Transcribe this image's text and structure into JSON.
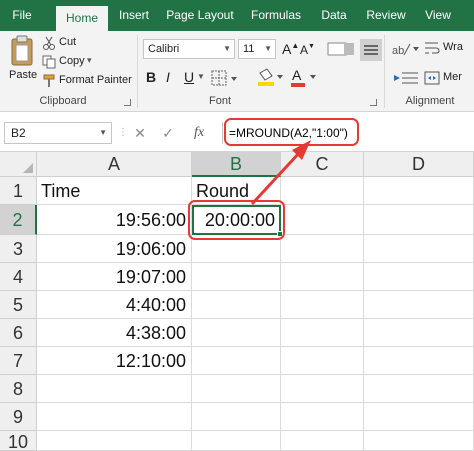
{
  "ribbon": {
    "tabs": [
      "File",
      "Home",
      "Insert",
      "Page Layout",
      "Formulas",
      "Data",
      "Review",
      "View"
    ],
    "active_tab": "Home",
    "clipboard": {
      "paste": "Paste",
      "cut": "Cut",
      "copy": "Copy",
      "copy_dropdown": "▾",
      "format_painter": "Format Painter",
      "group_label": "Clipboard"
    },
    "font": {
      "name": "Calibri",
      "size": "11",
      "grow": "A",
      "shrink": "A",
      "bold": "B",
      "italic": "I",
      "underline": "U",
      "font_color": "A",
      "group_label": "Font"
    },
    "alignment": {
      "wrap": "Wra",
      "merge": "Mer",
      "group_label": "Alignment"
    }
  },
  "formula_bar": {
    "name_box": "B2",
    "cancel": "✕",
    "enter": "✓",
    "fx": "fx",
    "formula": "=MROUND(A2,\"1:00\")"
  },
  "sheet": {
    "columns": [
      "A",
      "B",
      "C",
      "D"
    ],
    "selected_column": "B",
    "rows": [
      "1",
      "2",
      "3",
      "4",
      "5",
      "6",
      "7",
      "8",
      "9",
      "10"
    ],
    "selected_row": "2",
    "cells": {
      "A1": "Time",
      "B1": "Round",
      "A2": "19:56:00",
      "B2": "20:00:00",
      "A3": "19:06:00",
      "A4": "19:07:00",
      "A5": "4:40:00",
      "A6": "4:38:00",
      "A7": "12:10:00"
    }
  },
  "colors": {
    "excel_green": "#217346",
    "annotation_red": "#e53935",
    "font_color_red": "#e53935",
    "highlight_yellow": "#ffd700"
  }
}
